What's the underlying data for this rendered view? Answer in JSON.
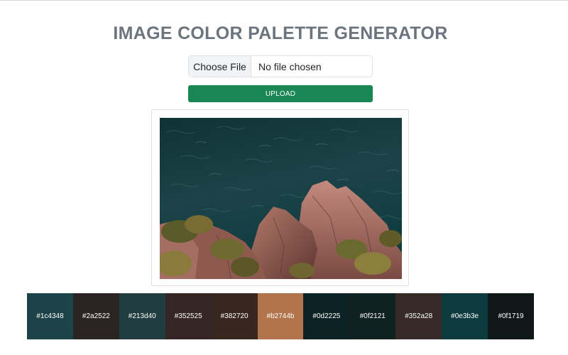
{
  "page": {
    "title": "IMAGE COLOR PALETTE GENERATOR"
  },
  "file_input": {
    "button_label": "Choose File",
    "status_text": "No file chosen"
  },
  "upload": {
    "label": "UPLOAD",
    "color": "#198754"
  },
  "preview": {
    "subject": "teal sea water over pink coastal rocks with shrubs"
  },
  "palette": [
    {
      "hex": "#1c4348"
    },
    {
      "hex": "#2a2522"
    },
    {
      "hex": "#213d40"
    },
    {
      "hex": "#352525"
    },
    {
      "hex": "#382720"
    },
    {
      "hex": "#b2744b"
    },
    {
      "hex": "#0d2225"
    },
    {
      "hex": "#0f2121"
    },
    {
      "hex": "#352a28"
    },
    {
      "hex": "#0e3b3e"
    },
    {
      "hex": "#0f1719"
    }
  ]
}
